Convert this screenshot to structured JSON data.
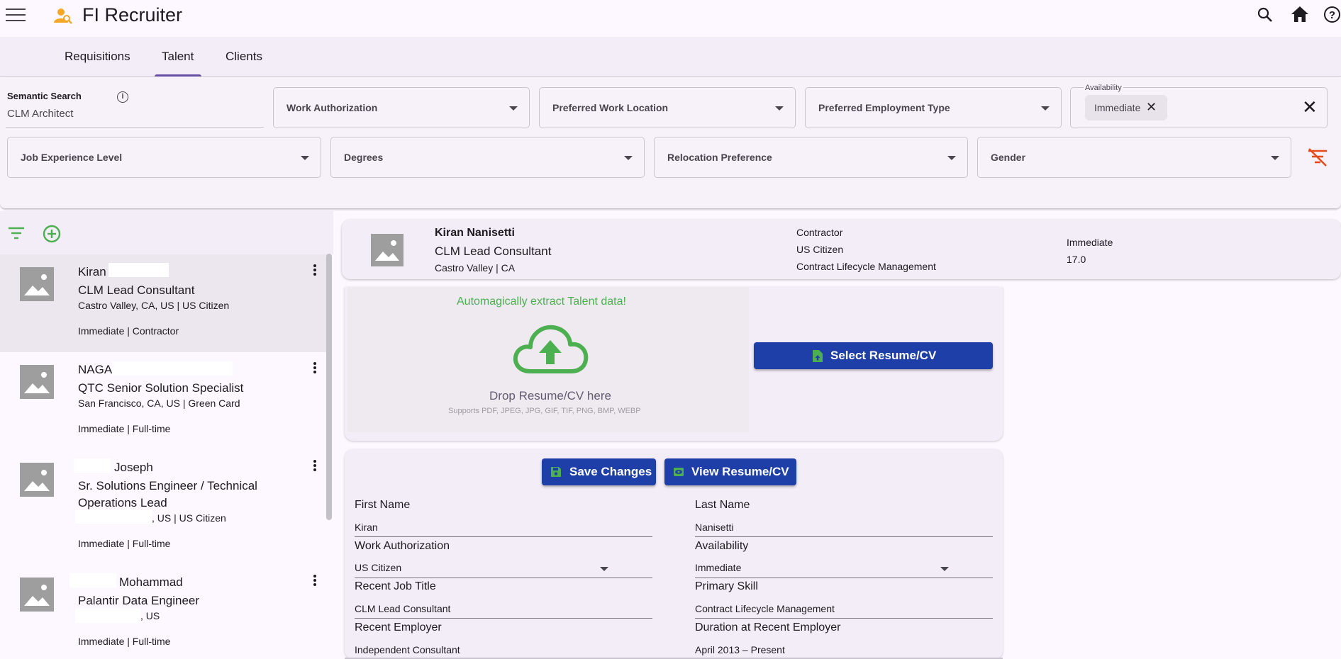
{
  "app": {
    "title": "FI Recruiter"
  },
  "tabs": [
    {
      "label": "Requisitions"
    },
    {
      "label": "Talent"
    },
    {
      "label": "Clients"
    }
  ],
  "filters": {
    "semantic_search_label": "Semantic Search",
    "semantic_search_value": "CLM Architect",
    "work_authorization": "Work Authorization",
    "preferred_work_location": "Preferred Work Location",
    "preferred_employment_type": "Preferred Employment Type",
    "availability_label": "Availability",
    "availability_chip": "Immediate",
    "job_experience_level": "Job Experience Level",
    "degrees": "Degrees",
    "relocation_preference": "Relocation Preference",
    "gender": "Gender"
  },
  "talent_list": [
    {
      "name": "Kiran",
      "title": "CLM Lead Consultant",
      "location": "Castro Valley, CA, US | US Citizen",
      "status": "Immediate | Contractor"
    },
    {
      "name": "NAGA",
      "title": "QTC Senior Solution Specialist",
      "location": "San Francisco, CA, US | Green Card",
      "status": "Immediate | Full-time"
    },
    {
      "name": "Joseph",
      "title": "Sr. Solutions Engineer / Technical Operations Lead",
      "location": ", US | US Citizen",
      "status": "Immediate | Full-time"
    },
    {
      "name": "Mohammad",
      "title": "Palantir Data Engineer",
      "location": ", US",
      "status": "Immediate | Full-time"
    }
  ],
  "detail": {
    "name": "Kiran Nanisetti",
    "title": "CLM Lead Consultant",
    "location": "Castro Valley | CA",
    "employment_type": "Contractor",
    "work_authorization": "US Citizen",
    "primary_skill": "Contract Lifecycle Management",
    "availability": "Immediate",
    "experience": "17.0"
  },
  "upload": {
    "headline": "Automagically extract Talent data!",
    "drop_text": "Drop Resume/CV here",
    "supports": "Supports PDF, JPEG, JPG, GIF, TIF, PNG, BMP, WEBP",
    "select_button": "Select Resume/CV"
  },
  "form": {
    "save_button": "Save Changes",
    "view_button": "View Resume/CV",
    "first_name_label": "First Name",
    "first_name": "Kiran",
    "last_name_label": "Last Name",
    "last_name": "Nanisetti",
    "work_authorization_label": "Work Authorization",
    "work_authorization": "US Citizen",
    "availability_label": "Availability",
    "availability": "Immediate",
    "recent_job_title_label": "Recent Job Title",
    "recent_job_title": "CLM Lead Consultant",
    "primary_skill_label": "Primary Skill",
    "primary_skill": "Contract Lifecycle Management",
    "recent_employer_label": "Recent Employer",
    "recent_employer": "Independent Consultant",
    "duration_label": "Duration at Recent Employer",
    "duration": "April 2013 – Present"
  },
  "icons": {
    "brand_color": "#f5a623",
    "accent": "#1e3ea8",
    "green": "#4caf50",
    "danger": "#e64a19"
  }
}
